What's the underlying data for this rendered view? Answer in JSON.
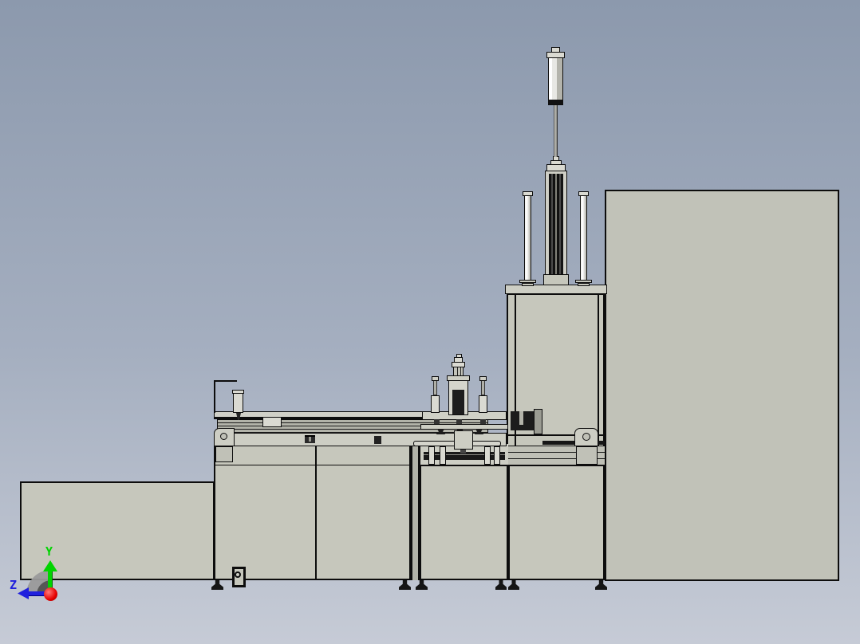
{
  "viewport": {
    "kind": "cad-3d-viewport-screenshot"
  },
  "axis_triad": {
    "labels": {
      "y": "Y",
      "z": "Z"
    },
    "colors": {
      "y_axis": "#00d400",
      "z_axis": "#2020dd",
      "origin": "#e60000",
      "arc": "#9a9a9a",
      "arc_dark": "#4f4f4f"
    }
  },
  "colors": {
    "bg_top": "#8c99ad",
    "bg_bottom": "#c6cbd6",
    "metal": "#c6c7bc",
    "metal_light": "#cdcec4",
    "metal_bright": "#dadad2",
    "metal_dark": "#b2b3a9",
    "panel": "#c1c2b8",
    "edge": "#0d0d0d",
    "dark": "#1c1c1c"
  }
}
